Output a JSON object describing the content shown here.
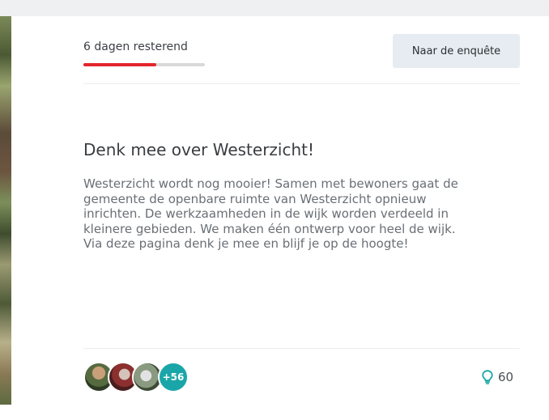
{
  "status": {
    "days_left_label": "6 dagen resterend",
    "progress_fraction": 0.6,
    "progress_color": "#e3262b"
  },
  "actions": {
    "survey_button_label": "Naar de enquête"
  },
  "project": {
    "title": "Denk mee over Westerzicht!",
    "description": "Westerzicht wordt nog mooier! Samen met bewoners gaat de gemeente de openbare ruimte van Westerzicht opnieuw inrichten. De werkzaamheden in de wijk worden verdeeld in kleinere gebieden. We maken één ontwerp voor heel de wijk. Via deze pagina denk je mee en blijf je op de hoogte!"
  },
  "participants": {
    "more_count_label": "+56",
    "more_badge_color": "#1aa6a8"
  },
  "ideas": {
    "icon": "lightbulb-icon",
    "count": "60",
    "icon_color": "#1aa6a8"
  }
}
